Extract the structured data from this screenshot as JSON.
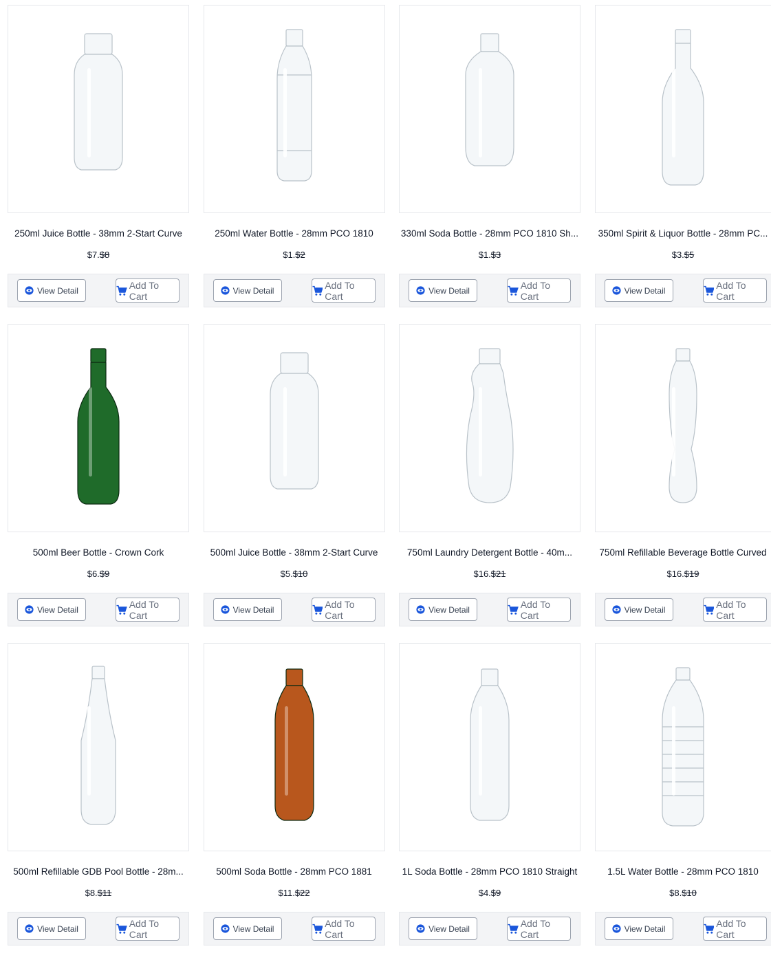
{
  "accent": "#1a56db",
  "labels": {
    "view": "View Detail",
    "cart": "Add To Cart"
  },
  "products": [
    {
      "title": "250ml Juice Bottle - 38mm 2-Start Curve",
      "price": "$7.",
      "old": "$8",
      "bottle": "juice",
      "color": "#e9eef2"
    },
    {
      "title": "250ml Water Bottle - 28mm PCO 1810",
      "price": "$1.",
      "old": "$2",
      "bottle": "water",
      "color": "#e9eef2"
    },
    {
      "title": "330ml Soda Bottle - 28mm PCO 1810 Sh...",
      "price": "$1.",
      "old": "$3",
      "bottle": "soda",
      "color": "#e9eef2"
    },
    {
      "title": "350ml Spirit & Liquor Bottle - 28mm PC...",
      "price": "$3.",
      "old": "$5",
      "bottle": "liquor",
      "color": "#e9eef2"
    },
    {
      "title": "500ml Beer Bottle - Crown Cork",
      "price": "$6.",
      "old": "$9",
      "bottle": "liquor",
      "color": "#1f6b2a"
    },
    {
      "title": "500ml Juice Bottle - 38mm 2-Start Curve",
      "price": "$5.",
      "old": "$10",
      "bottle": "juice",
      "color": "#e9eef2"
    },
    {
      "title": "750ml Laundry Detergent Bottle - 40m...",
      "price": "$16.",
      "old": "$21",
      "bottle": "detergent",
      "color": "#e9eef2"
    },
    {
      "title": "750ml Refillable Beverage Bottle Curved",
      "price": "$16.",
      "old": "$19",
      "bottle": "curved",
      "color": "#e9eef2"
    },
    {
      "title": "500ml Refillable GDB Pool Bottle - 28m...",
      "price": "$8.",
      "old": "$11",
      "bottle": "gdb",
      "color": "#e9eef2"
    },
    {
      "title": "500ml Soda Bottle - 28mm PCO 1881",
      "price": "$11.",
      "old": "$22",
      "bottle": "soda2",
      "color": "#b8571d"
    },
    {
      "title": "1L Soda Bottle - 28mm PCO 1810 Straight",
      "price": "$4.",
      "old": "$9",
      "bottle": "soda2",
      "color": "#e9eef2"
    },
    {
      "title": "1.5L Water Bottle - 28mm PCO 1810",
      "price": "$8.",
      "old": "$10",
      "bottle": "ribbed",
      "color": "#e9eef2"
    }
  ]
}
